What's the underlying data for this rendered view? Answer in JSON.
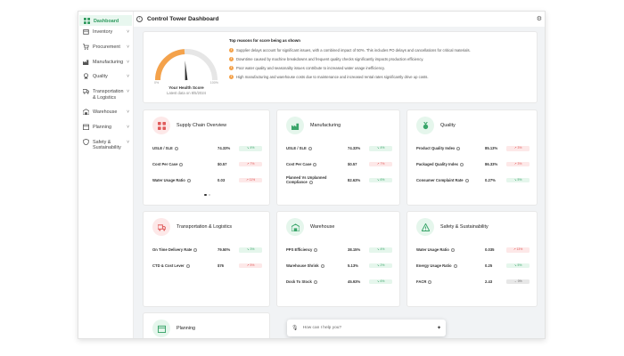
{
  "header": {
    "title": "Control Tower Dashboard",
    "collapse_icon": "collapse-sidebar-icon",
    "settings_icon": "gear-icon"
  },
  "sidebar": {
    "items": [
      {
        "label": "Dashboard",
        "icon": "grid-icon",
        "active": true,
        "chevron": ""
      },
      {
        "label": "Inventory",
        "icon": "box-icon",
        "chevron": "˅"
      },
      {
        "label": "Procurement",
        "icon": "cart-icon",
        "chevron": "˅"
      },
      {
        "label": "Manufacturing",
        "icon": "factory-icon",
        "chevron": "˅"
      },
      {
        "label": "Quality",
        "icon": "badge-icon",
        "chevron": "˅"
      },
      {
        "label": "Transportation & Logistics",
        "icon": "truck-icon",
        "chevron": "˅"
      },
      {
        "label": "Warehouse",
        "icon": "warehouse-icon",
        "chevron": "˅"
      },
      {
        "label": "Planning",
        "icon": "calendar-icon",
        "chevron": "˅"
      },
      {
        "label": "Safety & Sustainability",
        "icon": "shield-icon",
        "chevron": "˅"
      }
    ]
  },
  "health": {
    "score_label": "Your Health Score",
    "date_label": "Latest data on 8/5/2024",
    "score_fraction": 0.48,
    "min_label": "0%",
    "max_label": "100%",
    "reasons_title": "Top reasons for score being as shown",
    "reasons": [
      "Supplier delays account for significant issues, with a combined impact of 50%. This includes PO delays and cancellations for critical materials.",
      "Downtime caused by machine breakdowns and frequent quality checks significantly impacts production efficiency.",
      "Poor water quality and seasonality issues contribute to increased water usage inefficiency.",
      "High manufacturing and warehouse costs due to maintenance and increased rental rates significantly drive up costs."
    ]
  },
  "kpi_cards": [
    {
      "title": "Supply Chain Overview",
      "icon": "blocks-icon",
      "color": "#fde8e8",
      "icon_color": "#e05a5a",
      "rows": [
        {
          "name": "USLE / SLE",
          "value": "74.33%",
          "chip": "↘ 4%",
          "tone": "green"
        },
        {
          "name": "Cost Per Case",
          "value": "$0.57",
          "chip": "↗ 7%",
          "tone": "red"
        },
        {
          "name": "Water Usage Ratio",
          "value": "0.03",
          "chip": "↗ 11%",
          "tone": "red"
        }
      ]
    },
    {
      "title": "Manufacturing",
      "icon": "factory-icon",
      "color": "#e5f6ec",
      "icon_color": "#3aa56a",
      "rows": [
        {
          "name": "USLE / SLE",
          "value": "74.33%",
          "chip": "↘ 4%",
          "tone": "green"
        },
        {
          "name": "Cost Per Case",
          "value": "$0.57",
          "chip": "↗ 7%",
          "tone": "red"
        },
        {
          "name": "Planned Vs Unplanned Compliance",
          "value": "82.63%",
          "chip": "↘ 6%",
          "tone": "green"
        }
      ]
    },
    {
      "title": "Quality",
      "icon": "medal-icon",
      "color": "#e5f6ec",
      "icon_color": "#3aa56a",
      "rows": [
        {
          "name": "Product Quality Index",
          "value": "85.13%",
          "chip": "↗ 3%",
          "tone": "red"
        },
        {
          "name": "Packaged Quality Index",
          "value": "86.33%",
          "chip": "↗ 3%",
          "tone": "red"
        },
        {
          "name": "Consumer Complaint Rate",
          "value": "0.27%",
          "chip": "↘ 5%",
          "tone": "green"
        }
      ]
    },
    {
      "title": "Transportation & Logistics",
      "icon": "truck-icon",
      "color": "#fde8e8",
      "icon_color": "#e05a5a",
      "rows": [
        {
          "name": "On Time Delivery Rate",
          "value": "79.50%",
          "chip": "↘ 3%",
          "tone": "green"
        },
        {
          "name": "CTD & Cost Lever",
          "value": "$76",
          "chip": "↗ 5%",
          "tone": "red"
        }
      ]
    },
    {
      "title": "Warehouse",
      "icon": "warehouse-icon",
      "color": "#e5f6ec",
      "icon_color": "#3aa56a",
      "rows": [
        {
          "name": "PPS Efficiency",
          "value": "38.15%",
          "chip": "↘ 4%",
          "tone": "green"
        },
        {
          "name": "Warehouse Shrink",
          "value": "5.13%",
          "chip": "↘ 2%",
          "tone": "green"
        },
        {
          "name": "Dock To Stock",
          "value": "45.93%",
          "chip": "↘ 6%",
          "tone": "green"
        }
      ]
    },
    {
      "title": "Safety & Sustainability",
      "icon": "warning-icon",
      "color": "#e5f6ec",
      "icon_color": "#3aa56a",
      "rows": [
        {
          "name": "Water Usage Ratio",
          "value": "0.035",
          "chip": "↗ 13%",
          "tone": "red"
        },
        {
          "name": "Energy Usage Ratio",
          "value": "0.25",
          "chip": "↘ 5%",
          "tone": "green"
        },
        {
          "name": "FACR",
          "value": "2.43",
          "chip": "→ 0%",
          "tone": "gray"
        }
      ]
    },
    {
      "title": "Planning",
      "icon": "calendar-icon",
      "color": "#e5f6ec",
      "icon_color": "#3aa56a",
      "rows": []
    }
  ],
  "chat": {
    "placeholder": "How can I help you?",
    "mic_icon": "microphone-icon",
    "send_icon": "sparkle-icon"
  },
  "colors": {
    "accent_green": "#2e9a5e",
    "warning_orange": "#f4a24b",
    "negative_red": "#e05a5a"
  }
}
